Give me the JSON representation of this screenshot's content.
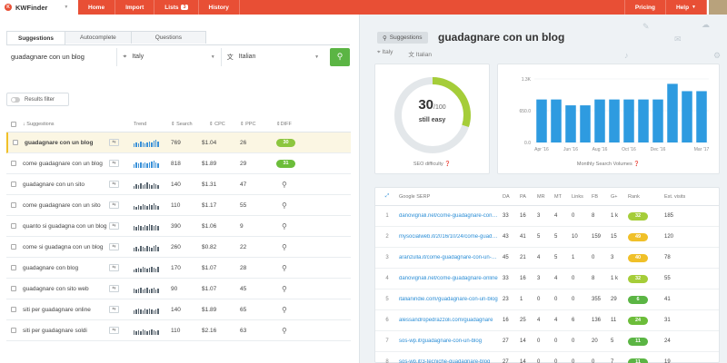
{
  "app": {
    "name": "KWFinder"
  },
  "nav": {
    "items": [
      "Home",
      "Import",
      "Lists",
      "History"
    ],
    "lists_count": "3",
    "right": [
      "Pricing",
      "Help"
    ]
  },
  "tabs": [
    "Suggestions",
    "Autocomplete",
    "Questions"
  ],
  "search": {
    "keyword": "guadagnare con un blog",
    "location": "Italy",
    "language": "Italian"
  },
  "filter_label": "Results filter",
  "table": {
    "headers": {
      "suggestions": "Suggestions",
      "trend": "Trend",
      "search": "Search",
      "cpc": "CPC",
      "ppc": "PPC",
      "diff": "DIFF"
    },
    "rows": [
      {
        "kw": "guadagnare con un blog",
        "search": "769",
        "cpc": "$1.04",
        "ppc": "26",
        "diff": "30",
        "color": "#8cc63f",
        "trend": [
          4,
          5,
          4,
          6,
          5,
          4,
          5,
          6,
          5,
          7,
          8,
          6
        ]
      },
      {
        "kw": "come guadagnare con un blog",
        "search": "818",
        "cpc": "$1.89",
        "ppc": "29",
        "diff": "31",
        "color": "#6cbd3a",
        "trend": [
          4,
          6,
          5,
          6,
          5,
          6,
          5,
          6,
          7,
          8,
          6,
          5
        ]
      },
      {
        "kw": "guadagnare con un sito",
        "search": "140",
        "cpc": "$1.31",
        "ppc": "47",
        "diff": "",
        "color": "",
        "trend": [
          3,
          5,
          4,
          6,
          4,
          5,
          7,
          5,
          4,
          6,
          5,
          4
        ]
      },
      {
        "kw": "come guadagnare con un sito",
        "search": "110",
        "cpc": "$1.17",
        "ppc": "55",
        "diff": "",
        "color": "",
        "trend": [
          4,
          3,
          5,
          4,
          6,
          5,
          4,
          6,
          5,
          7,
          5,
          4
        ]
      },
      {
        "kw": "quanto si guadagna con un blog",
        "search": "390",
        "cpc": "$1.06",
        "ppc": "9",
        "diff": "",
        "color": "",
        "trend": [
          5,
          4,
          6,
          5,
          4,
          6,
          5,
          7,
          6,
          5,
          6,
          5
        ]
      },
      {
        "kw": "come si guadagna con un blog",
        "search": "260",
        "cpc": "$0.82",
        "ppc": "22",
        "diff": "",
        "color": "",
        "trend": [
          4,
          5,
          3,
          6,
          5,
          4,
          6,
          5,
          4,
          6,
          7,
          5
        ]
      },
      {
        "kw": "guadagnare con blog",
        "search": "170",
        "cpc": "$1.07",
        "ppc": "28",
        "diff": "",
        "color": "",
        "trend": [
          3,
          4,
          5,
          4,
          6,
          5,
          4,
          5,
          6,
          5,
          4,
          6
        ]
      },
      {
        "kw": "guadagnare con sito web",
        "search": "90",
        "cpc": "$1.07",
        "ppc": "45",
        "diff": "",
        "color": "",
        "trend": [
          5,
          4,
          5,
          6,
          4,
          5,
          6,
          4,
          5,
          6,
          4,
          5
        ]
      },
      {
        "kw": "siti per guadagnare online",
        "search": "140",
        "cpc": "$1.89",
        "ppc": "65",
        "diff": "",
        "color": "",
        "trend": [
          4,
          5,
          6,
          5,
          4,
          6,
          5,
          6,
          5,
          4,
          5,
          6
        ]
      },
      {
        "kw": "siti per guadagnare soldi",
        "search": "110",
        "cpc": "$2.16",
        "ppc": "63",
        "diff": "",
        "color": "",
        "trend": [
          5,
          4,
          5,
          4,
          6,
          5,
          4,
          5,
          6,
          5,
          4,
          5
        ]
      }
    ]
  },
  "detail": {
    "tag": "Suggestions",
    "keyword": "guadagnare con un blog",
    "location": "Italy",
    "language": "Italian",
    "difficulty": {
      "value": "30",
      "max": "/100",
      "label": "still easy",
      "caption": "SEO difficulty",
      "fraction": 0.3
    },
    "volume_caption": "Monthly Search Volumes"
  },
  "chart_data": {
    "type": "bar",
    "categories": [
      "Apr '16",
      "May '16",
      "Jun '16",
      "Jul '16",
      "Aug '16",
      "Sep '16",
      "Oct '16",
      "Nov '16",
      "Dec '16",
      "Jan '17",
      "Feb '17",
      "Mar '17"
    ],
    "x_tick_labels": [
      "Apr '16",
      "Jun '16",
      "Aug '16",
      "Oct '16",
      "Dec '16",
      "Mar '17"
    ],
    "values": [
      880,
      880,
      760,
      760,
      880,
      880,
      880,
      880,
      880,
      1200,
      1050,
      1050
    ],
    "ylim": [
      0,
      1300
    ],
    "y_ticks": [
      "1.3K",
      "650.0",
      "0.0"
    ],
    "color": "#2e9be0"
  },
  "serp": {
    "headers": [
      "Google SERP",
      "DA",
      "PA",
      "MR",
      "MT",
      "Links",
      "FB",
      "G+",
      "Rank",
      "Est. visits"
    ],
    "rows": [
      {
        "n": "1",
        "url": "danovignali.net/come-guadagnare-con-un-blog",
        "da": "33",
        "pa": "16",
        "mr": "3",
        "mt": "4",
        "links": "0",
        "fb": "8",
        "g": "1 k",
        "rank": "32",
        "rc": "#a5cd39",
        "ev": "185"
      },
      {
        "n": "2",
        "url": "mysocialweb.it/2016/10/24/come-guadagnare",
        "da": "43",
        "pa": "41",
        "mr": "5",
        "mt": "5",
        "links": "10",
        "fb": "159",
        "g": "15",
        "rank": "49",
        "rc": "#f0c028",
        "ev": "120"
      },
      {
        "n": "3",
        "url": "aranzulla.it/come-guadagnare-con-un-blog",
        "da": "45",
        "pa": "21",
        "mr": "4",
        "mt": "5",
        "links": "1",
        "fb": "0",
        "g": "3",
        "rank": "40",
        "rc": "#f0c028",
        "ev": "78"
      },
      {
        "n": "4",
        "url": "danovignali.net/come-guadagnare-online",
        "da": "33",
        "pa": "16",
        "mr": "3",
        "mt": "4",
        "links": "0",
        "fb": "8",
        "g": "1 k",
        "rank": "32",
        "rc": "#a5cd39",
        "ev": "55"
      },
      {
        "n": "5",
        "url": "italianindie.com/guadagnare-con-un-blog",
        "da": "23",
        "pa": "1",
        "mr": "0",
        "mt": "0",
        "links": "0",
        "fb": "355",
        "g": "29",
        "rank": "6",
        "rc": "#5bb544",
        "ev": "41"
      },
      {
        "n": "6",
        "url": "alessandropedrazzoli.com/guadagnare",
        "da": "16",
        "pa": "25",
        "mr": "4",
        "mt": "4",
        "links": "6",
        "fb": "136",
        "g": "11",
        "rank": "24",
        "rc": "#6cbd3a",
        "ev": "31"
      },
      {
        "n": "7",
        "url": "sos-wp.it/guadagnare-con-un-blog",
        "da": "27",
        "pa": "14",
        "mr": "0",
        "mt": "0",
        "links": "0",
        "fb": "20",
        "g": "5",
        "rank": "11",
        "rc": "#5bb544",
        "ev": "24"
      },
      {
        "n": "8",
        "url": "sos-wp.it/3-tecniche-guadagnare-blog",
        "da": "27",
        "pa": "14",
        "mr": "0",
        "mt": "0",
        "links": "0",
        "fb": "0",
        "g": "7",
        "rank": "11",
        "rc": "#5bb544",
        "ev": "19"
      }
    ]
  }
}
